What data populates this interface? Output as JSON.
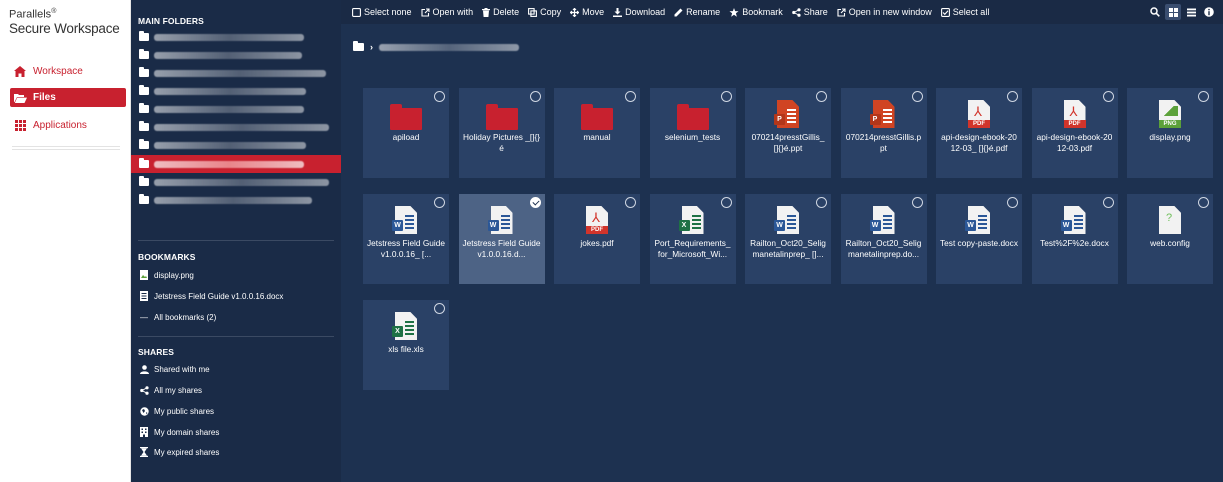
{
  "brand": {
    "top": "Parallels",
    "top_mark": "®",
    "bottom": "Secure Workspace"
  },
  "appnav": {
    "workspace": "Workspace",
    "files": "Files",
    "applications": "Applications"
  },
  "sidebar": {
    "main_folders_title": "MAIN FOLDERS",
    "bookmarks_title": "BOOKMARKS",
    "bookmarks": [
      "display.png",
      "Jetstress Field Guide v1.0.0.16.docx",
      "All bookmarks (2)"
    ],
    "shares_title": "SHARES",
    "shares": [
      "Shared with me",
      "All my shares",
      "My public shares",
      "My domain shares",
      "My expired shares"
    ]
  },
  "toolbar": {
    "select_none": "Select none",
    "open_with": "Open with",
    "delete": "Delete",
    "copy": "Copy",
    "move": "Move",
    "download": "Download",
    "rename": "Rename",
    "bookmark": "Bookmark",
    "share": "Share",
    "open_new_window": "Open in new window",
    "select_all": "Select all"
  },
  "files": [
    {
      "name": "apiload",
      "kind": "folder"
    },
    {
      "name": "Holiday Pictures _[]{}é",
      "kind": "folder"
    },
    {
      "name": "manual",
      "kind": "folder"
    },
    {
      "name": "selenium_tests",
      "kind": "folder"
    },
    {
      "name": "070214presstGillis_ []{}é.ppt",
      "kind": "ppt"
    },
    {
      "name": "070214presstGillis.ppt",
      "kind": "ppt"
    },
    {
      "name": "api-design-ebook-2012-03_ []{}é.pdf",
      "kind": "pdf"
    },
    {
      "name": "api-design-ebook-2012-03.pdf",
      "kind": "pdf"
    },
    {
      "name": "display.png",
      "kind": "png"
    },
    {
      "name": "Jetstress Field Guide v1.0.0.16_ [...",
      "kind": "doc"
    },
    {
      "name": "Jetstress Field Guide v1.0.0.16.d...",
      "kind": "doc",
      "selected": true
    },
    {
      "name": "jokes.pdf",
      "kind": "pdf"
    },
    {
      "name": "Port_Requirements_for_Microsoft_Wi...",
      "kind": "xls"
    },
    {
      "name": "Railton_Oct20_Seligmanetalinprep_ []...",
      "kind": "doc"
    },
    {
      "name": "Railton_Oct20_Seligmanetalinprep.do...",
      "kind": "doc"
    },
    {
      "name": "Test copy-paste.docx",
      "kind": "doc"
    },
    {
      "name": "Test%2F%2e.docx",
      "kind": "doc"
    },
    {
      "name": "web.config",
      "kind": "unknown"
    },
    {
      "name": "xls file.xls",
      "kind": "xls"
    }
  ],
  "badges": {
    "ppt": "P",
    "doc": "W",
    "xls": "X",
    "pdf": "PDF",
    "png": "PNG",
    "unknown": "?"
  },
  "colors": {
    "accent": "#c8212f",
    "sidebar": "#1a2b47",
    "main": "#1d3150",
    "tile": "#2a4166",
    "ppt": "#d04423",
    "doc": "#2b5797",
    "xls": "#1e7145",
    "pdf": "#d1342b",
    "png": "#5ca13a"
  }
}
